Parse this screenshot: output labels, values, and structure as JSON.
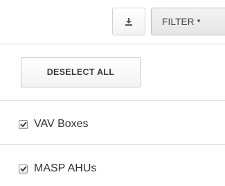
{
  "toolbar": {
    "download_icon": "download-icon",
    "filter_label": "FILTER",
    "filter_caret": "▾"
  },
  "filter_panel": {
    "deselect_all_label": "DESELECT ALL",
    "options": [
      {
        "label": "VAV Boxes",
        "checked": true
      },
      {
        "label": "MASP AHUs",
        "checked": true
      }
    ]
  },
  "colors": {
    "border": "#cfcfcf",
    "text": "#333333",
    "divider": "#dcdcdc"
  }
}
